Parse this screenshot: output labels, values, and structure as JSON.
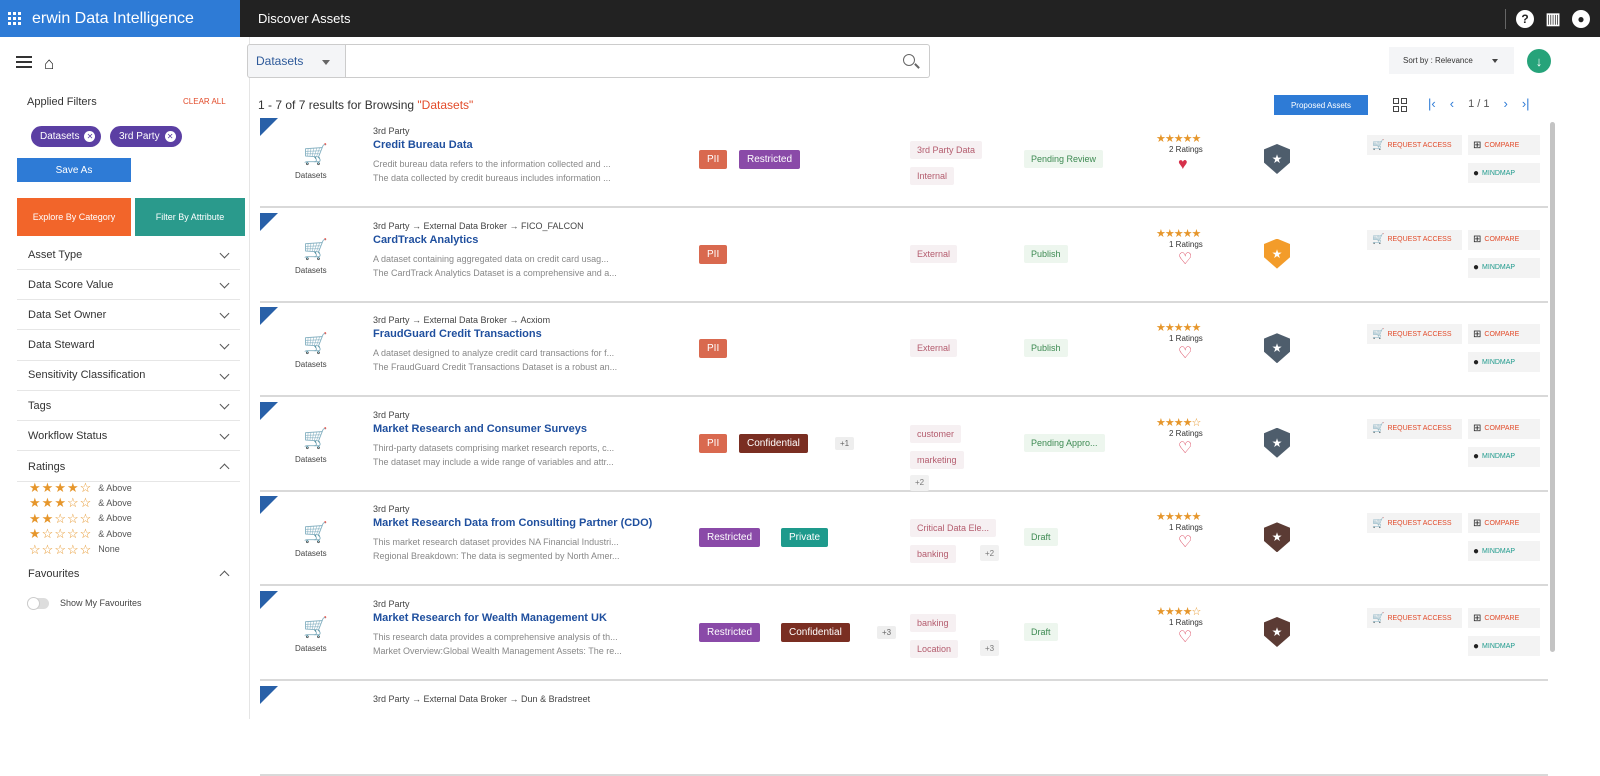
{
  "app": {
    "brand": "erwin Data Intelligence",
    "page_title": "Discover Assets"
  },
  "left": {
    "applied_filters": "Applied Filters",
    "clear_all": "CLEAR ALL",
    "chips": [
      "Datasets",
      "3rd Party"
    ],
    "save_as": "Save As",
    "explore_by_category": "Explore By Category",
    "filter_by_attribute": "Filter By Attribute",
    "filters": [
      "Asset Type",
      "Data Score Value",
      "Data Set Owner",
      "Data Steward",
      "Sensitivity Classification",
      "Tags",
      "Workflow Status"
    ],
    "ratings": {
      "label": "Ratings",
      "rows": [
        {
          "filled": 4,
          "text": "& Above"
        },
        {
          "filled": 3,
          "text": "& Above"
        },
        {
          "filled": 2,
          "text": "& Above"
        },
        {
          "filled": 1,
          "text": "& Above"
        },
        {
          "filled": 0,
          "text": "None"
        }
      ]
    },
    "favourites": {
      "label": "Favourites",
      "toggle_label": "Show My Favourites",
      "enabled": false
    }
  },
  "search": {
    "dataset_select": "Datasets",
    "query": "",
    "sort": "Sort by : Relevance"
  },
  "results": {
    "summary_prefix": "1 - 7 of 7 results for Browsing ",
    "summary_term": "\"Datasets\"",
    "proposed_assets": "Proposed Assets",
    "page": "1 / 1"
  },
  "actions": {
    "request_access": "REQUEST ACCESS",
    "compare": "COMPARE",
    "mindmap": "MINDMAP"
  },
  "cards": [
    {
      "type": "Datasets",
      "path": "3rd Party",
      "title": "Credit Bureau Data",
      "desc1": "Credit bureau data refers to the information collected and ...",
      "desc2": "The data collected by credit bureaus includes information ...",
      "tags": [
        "PII",
        "Restricted"
      ],
      "extra_tags": "",
      "labels": [
        "3rd Party Data",
        "Internal"
      ],
      "label_more": "",
      "status": "Pending Review",
      "stars": 5,
      "ratings": "2 Ratings",
      "favourite": true,
      "badge": "gray"
    },
    {
      "type": "Datasets",
      "path": "3rd Party → External Data Broker → FICO_FALCON",
      "title": "CardTrack Analytics",
      "desc1": "A dataset containing aggregated data on credit card usag...",
      "desc2": "The CardTrack Analytics Dataset is a comprehensive and a...",
      "tags": [
        "PII"
      ],
      "extra_tags": "",
      "labels": [
        "External"
      ],
      "label_more": "",
      "status": "Publish",
      "stars": 5,
      "ratings": "1 Ratings",
      "favourite": false,
      "badge": "gold"
    },
    {
      "type": "Datasets",
      "path": "3rd Party → External Data Broker → Acxiom",
      "title": "FraudGuard Credit Transactions",
      "desc1": "A dataset designed to analyze credit card transactions for f...",
      "desc2": "The FraudGuard Credit Transactions Dataset is a robust an...",
      "tags": [
        "PII"
      ],
      "extra_tags": "",
      "labels": [
        "External"
      ],
      "label_more": "",
      "status": "Publish",
      "stars": 5,
      "ratings": "1 Ratings",
      "favourite": false,
      "badge": "gray"
    },
    {
      "type": "Datasets",
      "path": "3rd Party",
      "title": "Market Research and Consumer Surveys",
      "desc1": "Third-party datasets comprising market research reports, c...",
      "desc2": "The dataset may include a wide range of variables and attr...",
      "tags": [
        "PII",
        "Confidential"
      ],
      "extra_tags": "+1",
      "labels": [
        "customer",
        "marketing"
      ],
      "label_more": "+2",
      "status": "Pending Appro...",
      "stars": 4,
      "ratings": "2 Ratings",
      "favourite": false,
      "badge": "gray"
    },
    {
      "type": "Datasets",
      "path": "3rd Party",
      "title": "Market Research Data from Consulting Partner (CDO)",
      "desc1": "This market research dataset provides NA Financial Industri...",
      "desc2": "Regional Breakdown: The data is segmented by North Amer...",
      "tags": [
        "Restricted",
        "Private"
      ],
      "extra_tags": "",
      "labels": [
        "Critical Data Ele...",
        "banking"
      ],
      "label_more": "+2",
      "status": "Draft",
      "stars": 5,
      "ratings": "1 Ratings",
      "favourite": false,
      "badge": "brown"
    },
    {
      "type": "Datasets",
      "path": "3rd Party",
      "title": "Market Research for Wealth Management UK",
      "desc1": "This research data provides a comprehensive analysis of th...",
      "desc2": "Market Overview:Global Wealth Management Assets: The re...",
      "tags": [
        "Restricted",
        "Confidential"
      ],
      "extra_tags": "+3",
      "labels": [
        "banking",
        "Location"
      ],
      "label_more": "+3",
      "status": "Draft",
      "stars": 4,
      "ratings": "1 Ratings",
      "favourite": false,
      "badge": "brown"
    },
    {
      "type": "",
      "path": "3rd Party → External Data Broker → Dun & Bradstreet",
      "title": "",
      "desc1": "",
      "desc2": "",
      "tags": [],
      "extra_tags": "",
      "labels": [],
      "label_more": "",
      "status": "",
      "stars": 0,
      "ratings": "",
      "favourite": false,
      "badge": ""
    }
  ],
  "icons": {
    "menu": "hamburger-icon",
    "home": "home-icon",
    "help": "help-icon",
    "apps": "apps-icon",
    "user": "user-icon",
    "search": "search-icon",
    "download": "download-icon",
    "cart": "cart-icon",
    "shield": "shield-star-icon",
    "heart": "heart-icon",
    "mindmap": "pin-icon"
  }
}
